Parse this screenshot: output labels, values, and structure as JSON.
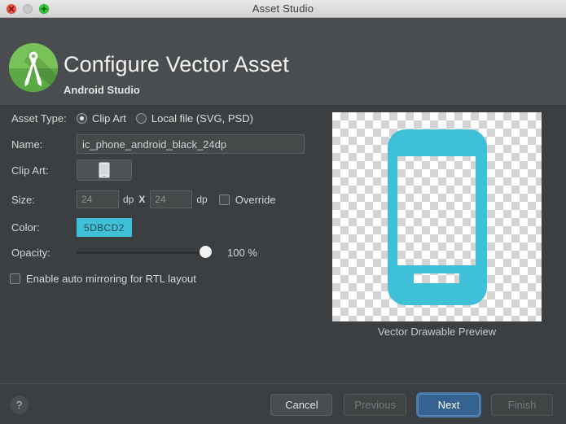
{
  "window": {
    "title": "Asset Studio",
    "traffic_lights": [
      {
        "name": "close",
        "glyph": "×"
      },
      {
        "name": "minimize",
        "glyph": ""
      },
      {
        "name": "maximize",
        "glyph": "+"
      }
    ]
  },
  "header": {
    "title": "Configure Vector Asset",
    "subtitle": "Android Studio",
    "logo_icon": "android-studio-logo-icon"
  },
  "form": {
    "asset_type": {
      "label": "Asset Type:",
      "options": [
        {
          "label": "Clip Art",
          "selected": true
        },
        {
          "label": "Local file (SVG, PSD)",
          "selected": false
        }
      ]
    },
    "name": {
      "label": "Name:",
      "value": "ic_phone_android_black_24dp",
      "placeholder": "ic_phone_android_black_24dp"
    },
    "clip_art": {
      "label": "Clip Art:",
      "icon": "phone-android-icon"
    },
    "size": {
      "label": "Size:",
      "width_value": "24",
      "height_value": "24",
      "unit_1": "dp",
      "separator": "X",
      "unit_2": "dp",
      "override_label": "Override",
      "override_checked": false
    },
    "color": {
      "label": "Color:",
      "hex_text": "5DBCD2",
      "swatch_color": "#3dc0d8"
    },
    "opacity": {
      "label": "Opacity:",
      "value_text": "100 %",
      "value": 100,
      "min": 0,
      "max": 100
    },
    "mirror": {
      "label": "Enable auto mirroring for RTL layout",
      "checked": false
    }
  },
  "preview": {
    "caption": "Vector Drawable Preview",
    "icon": "phone-android-icon",
    "icon_color": "#3dc0d8"
  },
  "footer": {
    "help_label": "?",
    "buttons": [
      {
        "label": "Cancel",
        "state": "enabled"
      },
      {
        "label": "Previous",
        "state": "disabled"
      },
      {
        "label": "Next",
        "state": "primary"
      },
      {
        "label": "Finish",
        "state": "disabled"
      }
    ]
  }
}
